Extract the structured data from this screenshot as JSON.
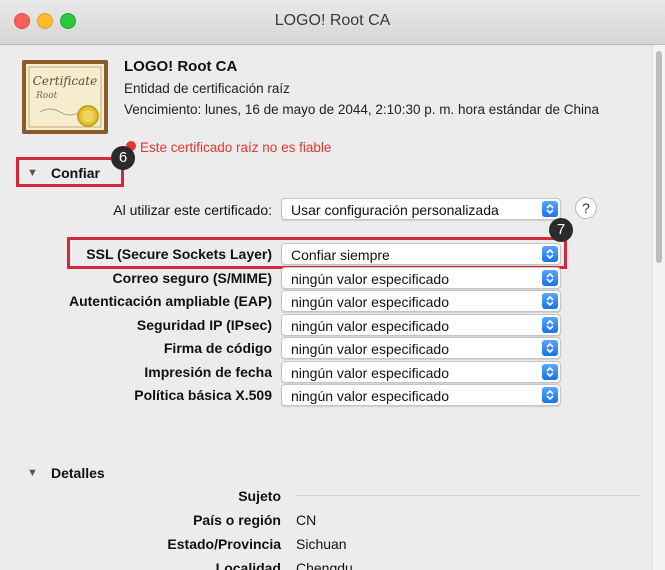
{
  "window": {
    "title": "LOGO! Root CA"
  },
  "certificate": {
    "icon_text": "Certificate",
    "icon_subtext": "Root",
    "name": "LOGO! Root CA",
    "type": "Entidad de certificación raíz",
    "expiry": "Vencimiento: lunes, 16 de mayo de 2044, 2:10:30 p. m. hora estándar de China",
    "status": "Este certificado raíz no es fiable",
    "status_color": "#e4362f"
  },
  "annotations": {
    "marker_trust": "6",
    "marker_ssl": "7",
    "color": "#d3283b"
  },
  "trust": {
    "title": "Confiar",
    "when_using_label": "Al utilizar este certificado:",
    "when_using_value": "Usar configuración personalizada",
    "help": "?",
    "rows": [
      {
        "label": "SSL (Secure Sockets Layer)",
        "value": "Confiar siempre"
      },
      {
        "label": "Correo seguro (S/MIME)",
        "value": "ningún valor especificado"
      },
      {
        "label": "Autenticación ampliable (EAP)",
        "value": "ningún valor especificado"
      },
      {
        "label": "Seguridad IP (IPsec)",
        "value": "ningún valor especificado"
      },
      {
        "label": "Firma de código",
        "value": "ningún valor especificado"
      },
      {
        "label": "Impresión de fecha",
        "value": "ningún valor especificado"
      },
      {
        "label": "Política básica X.509",
        "value": "ningún valor especificado"
      }
    ]
  },
  "details": {
    "title": "Detalles",
    "subject_heading": "Sujeto",
    "fields": [
      {
        "label": "País o región",
        "value": "CN"
      },
      {
        "label": "Estado/Provincia",
        "value": "Sichuan"
      },
      {
        "label": "Localidad",
        "value": "Chengdu"
      }
    ]
  },
  "colors": {
    "accent": "#1b73e8",
    "window_bg": "#ececec"
  }
}
